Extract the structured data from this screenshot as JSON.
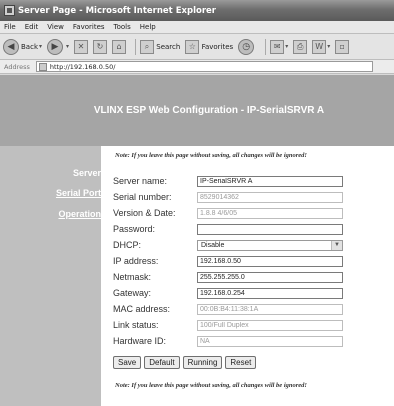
{
  "window": {
    "title": "Server Page - Microsoft Internet Explorer"
  },
  "menu": [
    "File",
    "Edit",
    "View",
    "Favorites",
    "Tools",
    "Help"
  ],
  "toolbar": {
    "back": "Back",
    "search": "Search",
    "favorites": "Favorites"
  },
  "address": {
    "label": "Address",
    "url": "http://192.168.0.50/"
  },
  "banner": {
    "title": "VLINX ESP Web Configuration - IP-SerialSRVR A"
  },
  "sidebar": {
    "items": [
      "Server",
      "Serial Port",
      "Operation"
    ]
  },
  "note_top": "Note: If you leave this page without saving, all changes will be ignored!",
  "note_bottom": "Note: If you leave this page without saving, all changes will be ignored!",
  "form": {
    "server_name": {
      "label": "Server name:",
      "value": "IP-SerialSRVR A"
    },
    "serial_number": {
      "label": "Serial number:",
      "value": "8529014362"
    },
    "version_date": {
      "label": "Version & Date:",
      "value": "1.8.8 4/6/05"
    },
    "password": {
      "label": "Password:",
      "value": ""
    },
    "dhcp": {
      "label": "DHCP:",
      "value": "Disable"
    },
    "ip_address": {
      "label": "IP address:",
      "value": "192.168.0.50"
    },
    "netmask": {
      "label": "Netmask:",
      "value": "255.255.255.0"
    },
    "gateway": {
      "label": "Gateway:",
      "value": "192.168.0.254"
    },
    "mac_address": {
      "label": "MAC address:",
      "value": "00:0B:B4:11:38:1A"
    },
    "link_status": {
      "label": "Link status:",
      "value": "100/Full Duplex"
    },
    "hardware_id": {
      "label": "Hardware ID:",
      "value": "NA"
    }
  },
  "buttons": {
    "save": "Save",
    "default": "Default",
    "running": "Running",
    "reset": "Reset"
  }
}
